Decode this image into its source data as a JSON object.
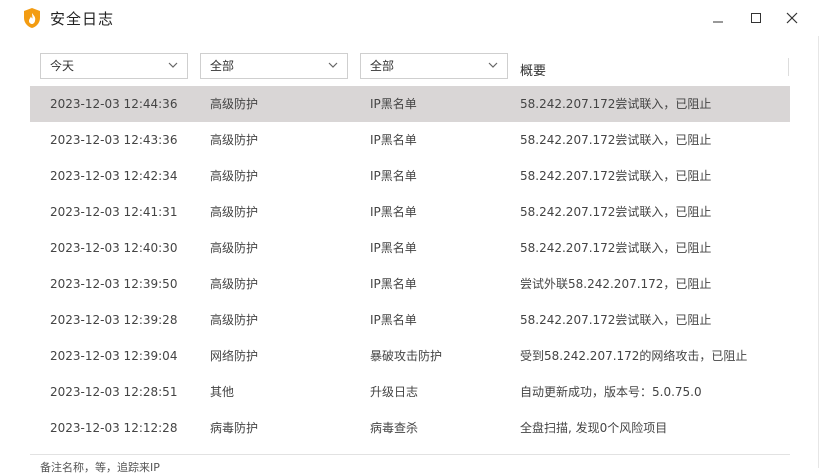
{
  "window": {
    "title": "安全日志",
    "icon": "flame-shield-icon",
    "brand_color": "#f39c12"
  },
  "filters": {
    "date": {
      "value": "今天"
    },
    "type": {
      "value": "全部"
    },
    "category": {
      "value": "全部"
    },
    "summary_header": "概要"
  },
  "rows": [
    {
      "time": "2023-12-03 12:44:36",
      "type": "高级防护",
      "category": "IP黑名单",
      "desc": "58.242.207.172尝试联入，已阻止",
      "selected": true
    },
    {
      "time": "2023-12-03 12:43:36",
      "type": "高级防护",
      "category": "IP黑名单",
      "desc": "58.242.207.172尝试联入，已阻止"
    },
    {
      "time": "2023-12-03 12:42:34",
      "type": "高级防护",
      "category": "IP黑名单",
      "desc": "58.242.207.172尝试联入，已阻止"
    },
    {
      "time": "2023-12-03 12:41:31",
      "type": "高级防护",
      "category": "IP黑名单",
      "desc": "58.242.207.172尝试联入，已阻止"
    },
    {
      "time": "2023-12-03 12:40:30",
      "type": "高级防护",
      "category": "IP黑名单",
      "desc": "58.242.207.172尝试联入，已阻止"
    },
    {
      "time": "2023-12-03 12:39:50",
      "type": "高级防护",
      "category": "IP黑名单",
      "desc": "尝试外联58.242.207.172，已阻止"
    },
    {
      "time": "2023-12-03 12:39:28",
      "type": "高级防护",
      "category": "IP黑名单",
      "desc": "58.242.207.172尝试联入，已阻止"
    },
    {
      "time": "2023-12-03 12:39:04",
      "type": "网络防护",
      "category": "暴破攻击防护",
      "desc": "受到58.242.207.172的网络攻击，已阻止"
    },
    {
      "time": "2023-12-03 12:28:51",
      "type": "其他",
      "category": "升级日志",
      "desc": "自动更新成功，版本号：5.0.75.0"
    },
    {
      "time": "2023-12-03 12:12:28",
      "type": "病毒防护",
      "category": "病毒查杀",
      "desc": "全盘扫描, 发现0个风险项目"
    }
  ],
  "footer": {
    "text": "备注名称，等，追踪来IP"
  },
  "colors": {
    "selected_row": "#d9d6d6",
    "border": "#cfcfcf"
  }
}
